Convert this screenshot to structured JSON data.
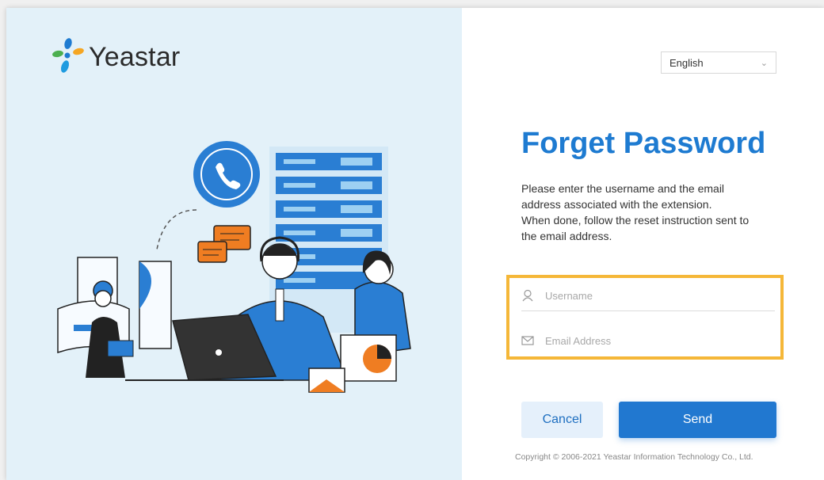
{
  "brand": {
    "name": "Yeastar"
  },
  "language": {
    "selected": "English"
  },
  "form": {
    "title": "Forget Password",
    "description": [
      "Please enter the username and the email",
      "address associated with the extension.",
      "When done, follow the reset instruction sent to",
      "the email address."
    ],
    "username": {
      "placeholder": "Username",
      "value": "",
      "icon": "user-icon"
    },
    "email": {
      "placeholder": "Email Address",
      "value": "",
      "icon": "envelope-icon"
    },
    "cancel_label": "Cancel",
    "send_label": "Send"
  },
  "footer": {
    "copyright": "Copyright © 2006-2021 Yeastar Information Technology Co., Ltd."
  },
  "colors": {
    "primary": "#2178d0",
    "title": "#1e7bd1",
    "highlight": "#f5b738",
    "left_bg": "#e3f1f9",
    "accent_orange": "#ef7d22"
  }
}
